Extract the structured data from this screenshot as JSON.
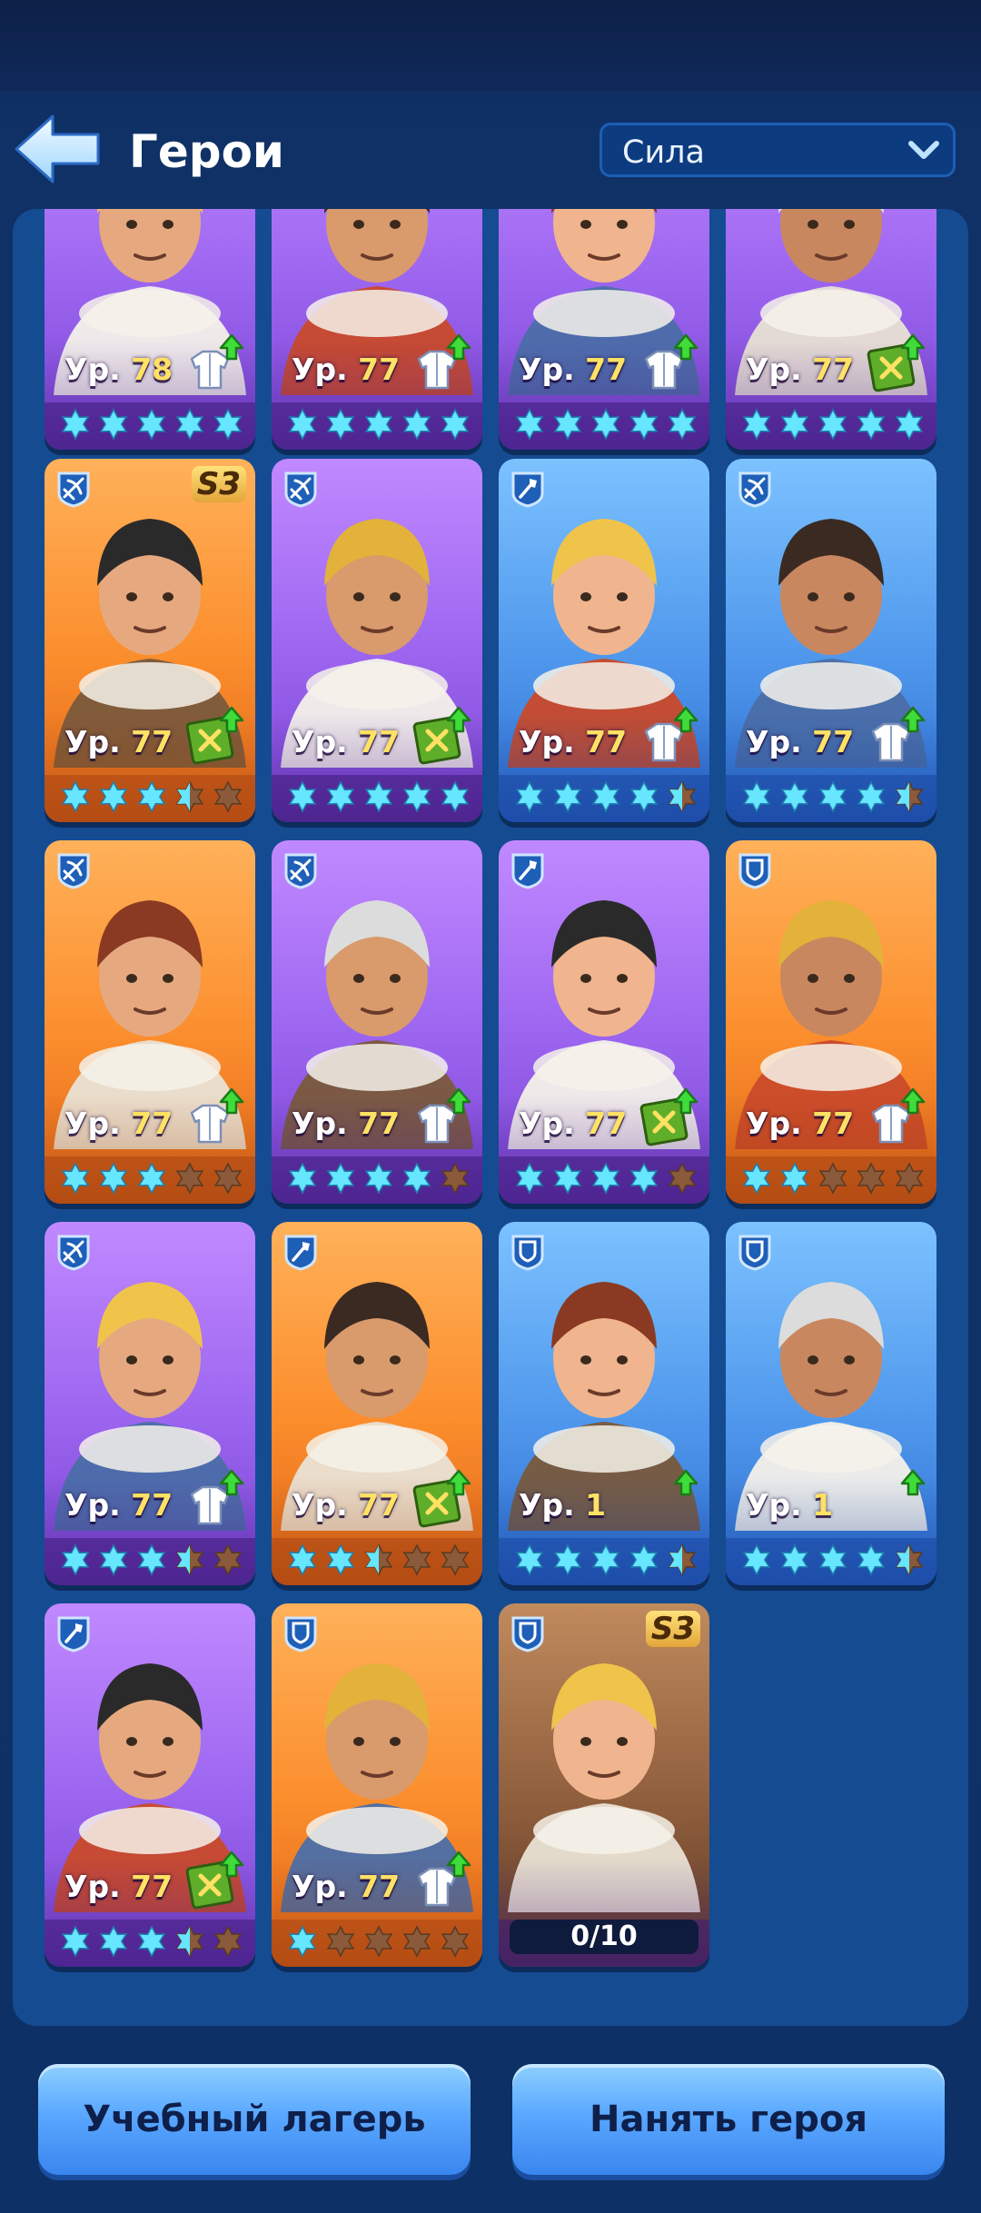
{
  "header": {
    "title": "Герои",
    "sort_select": {
      "selected": "Сила"
    }
  },
  "heroes": [
    {
      "level_prefix": "Ур.",
      "level": "78",
      "badge": "armor-upgrade",
      "role": "unknown",
      "stars_filled": 5,
      "color": "purple"
    },
    {
      "level_prefix": "Ур.",
      "level": "77",
      "badge": "armor-upgrade",
      "role": "unknown",
      "stars_filled": 5,
      "color": "purple"
    },
    {
      "level_prefix": "Ур.",
      "level": "77",
      "badge": "armor-upgrade",
      "role": "unknown",
      "stars_filled": 5,
      "color": "purple"
    },
    {
      "level_prefix": "Ур.",
      "level": "77",
      "badge": "manual-upgrade",
      "role": "unknown",
      "stars_filled": 5,
      "color": "purple"
    },
    {
      "level_prefix": "Ур.",
      "level": "77",
      "badge": "manual-upgrade",
      "role": "crossbow",
      "season": "S3",
      "stars_filled": 3.5,
      "color": "orange"
    },
    {
      "level_prefix": "Ур.",
      "level": "77",
      "badge": "manual-upgrade",
      "role": "crossbow",
      "stars_filled": 5,
      "color": "purple"
    },
    {
      "level_prefix": "Ур.",
      "level": "77",
      "badge": "armor-upgrade",
      "role": "shovel",
      "stars_filled": 4.5,
      "color": "blue"
    },
    {
      "level_prefix": "Ур.",
      "level": "77",
      "badge": "armor-upgrade",
      "role": "crossbow",
      "stars_filled": 4.5,
      "color": "blue"
    },
    {
      "level_prefix": "Ур.",
      "level": "77",
      "badge": "armor-upgrade",
      "role": "crossbow",
      "stars_filled": 3,
      "color": "orange"
    },
    {
      "level_prefix": "Ур.",
      "level": "77",
      "badge": "armor-upgrade",
      "role": "crossbow",
      "stars_filled": 4,
      "color": "purple"
    },
    {
      "level_prefix": "Ур.",
      "level": "77",
      "badge": "manual-upgrade",
      "role": "shovel",
      "stars_filled": 4,
      "color": "purple"
    },
    {
      "level_prefix": "Ур.",
      "level": "77",
      "badge": "armor-upgrade",
      "role": "shield",
      "stars_filled": 2,
      "color": "orange"
    },
    {
      "level_prefix": "Ур.",
      "level": "77",
      "badge": "armor-upgrade",
      "role": "crossbow",
      "stars_filled": 3.5,
      "color": "purple"
    },
    {
      "level_prefix": "Ур.",
      "level": "77",
      "badge": "manual-upgrade",
      "role": "shovel",
      "stars_filled": 2.5,
      "color": "orange"
    },
    {
      "level_prefix": "Ур.",
      "level": "1",
      "badge": "arrow-upgrade",
      "role": "shield",
      "stars_filled": 4.5,
      "color": "blue"
    },
    {
      "level_prefix": "Ур.",
      "level": "1",
      "badge": "arrow-upgrade",
      "role": "shield",
      "stars_filled": 4.5,
      "color": "blue"
    },
    {
      "level_prefix": "Ур.",
      "level": "77",
      "badge": "manual-upgrade",
      "role": "shovel",
      "stars_filled": 3.5,
      "color": "purple"
    },
    {
      "level_prefix": "Ур.",
      "level": "77",
      "badge": "armor-upgrade",
      "role": "shield",
      "stars_filled": 1,
      "color": "orange"
    },
    {
      "locked": true,
      "progress": "0/10",
      "role": "shield",
      "season": "S3",
      "color": "locked"
    }
  ],
  "buttons": {
    "training_camp": "Учебный лагерь",
    "hire_hero": "Нанять героя"
  },
  "colors": {
    "star_filled": "#66e6ff",
    "star_empty": "#8a5a3a",
    "level_number": "#ffe163"
  }
}
